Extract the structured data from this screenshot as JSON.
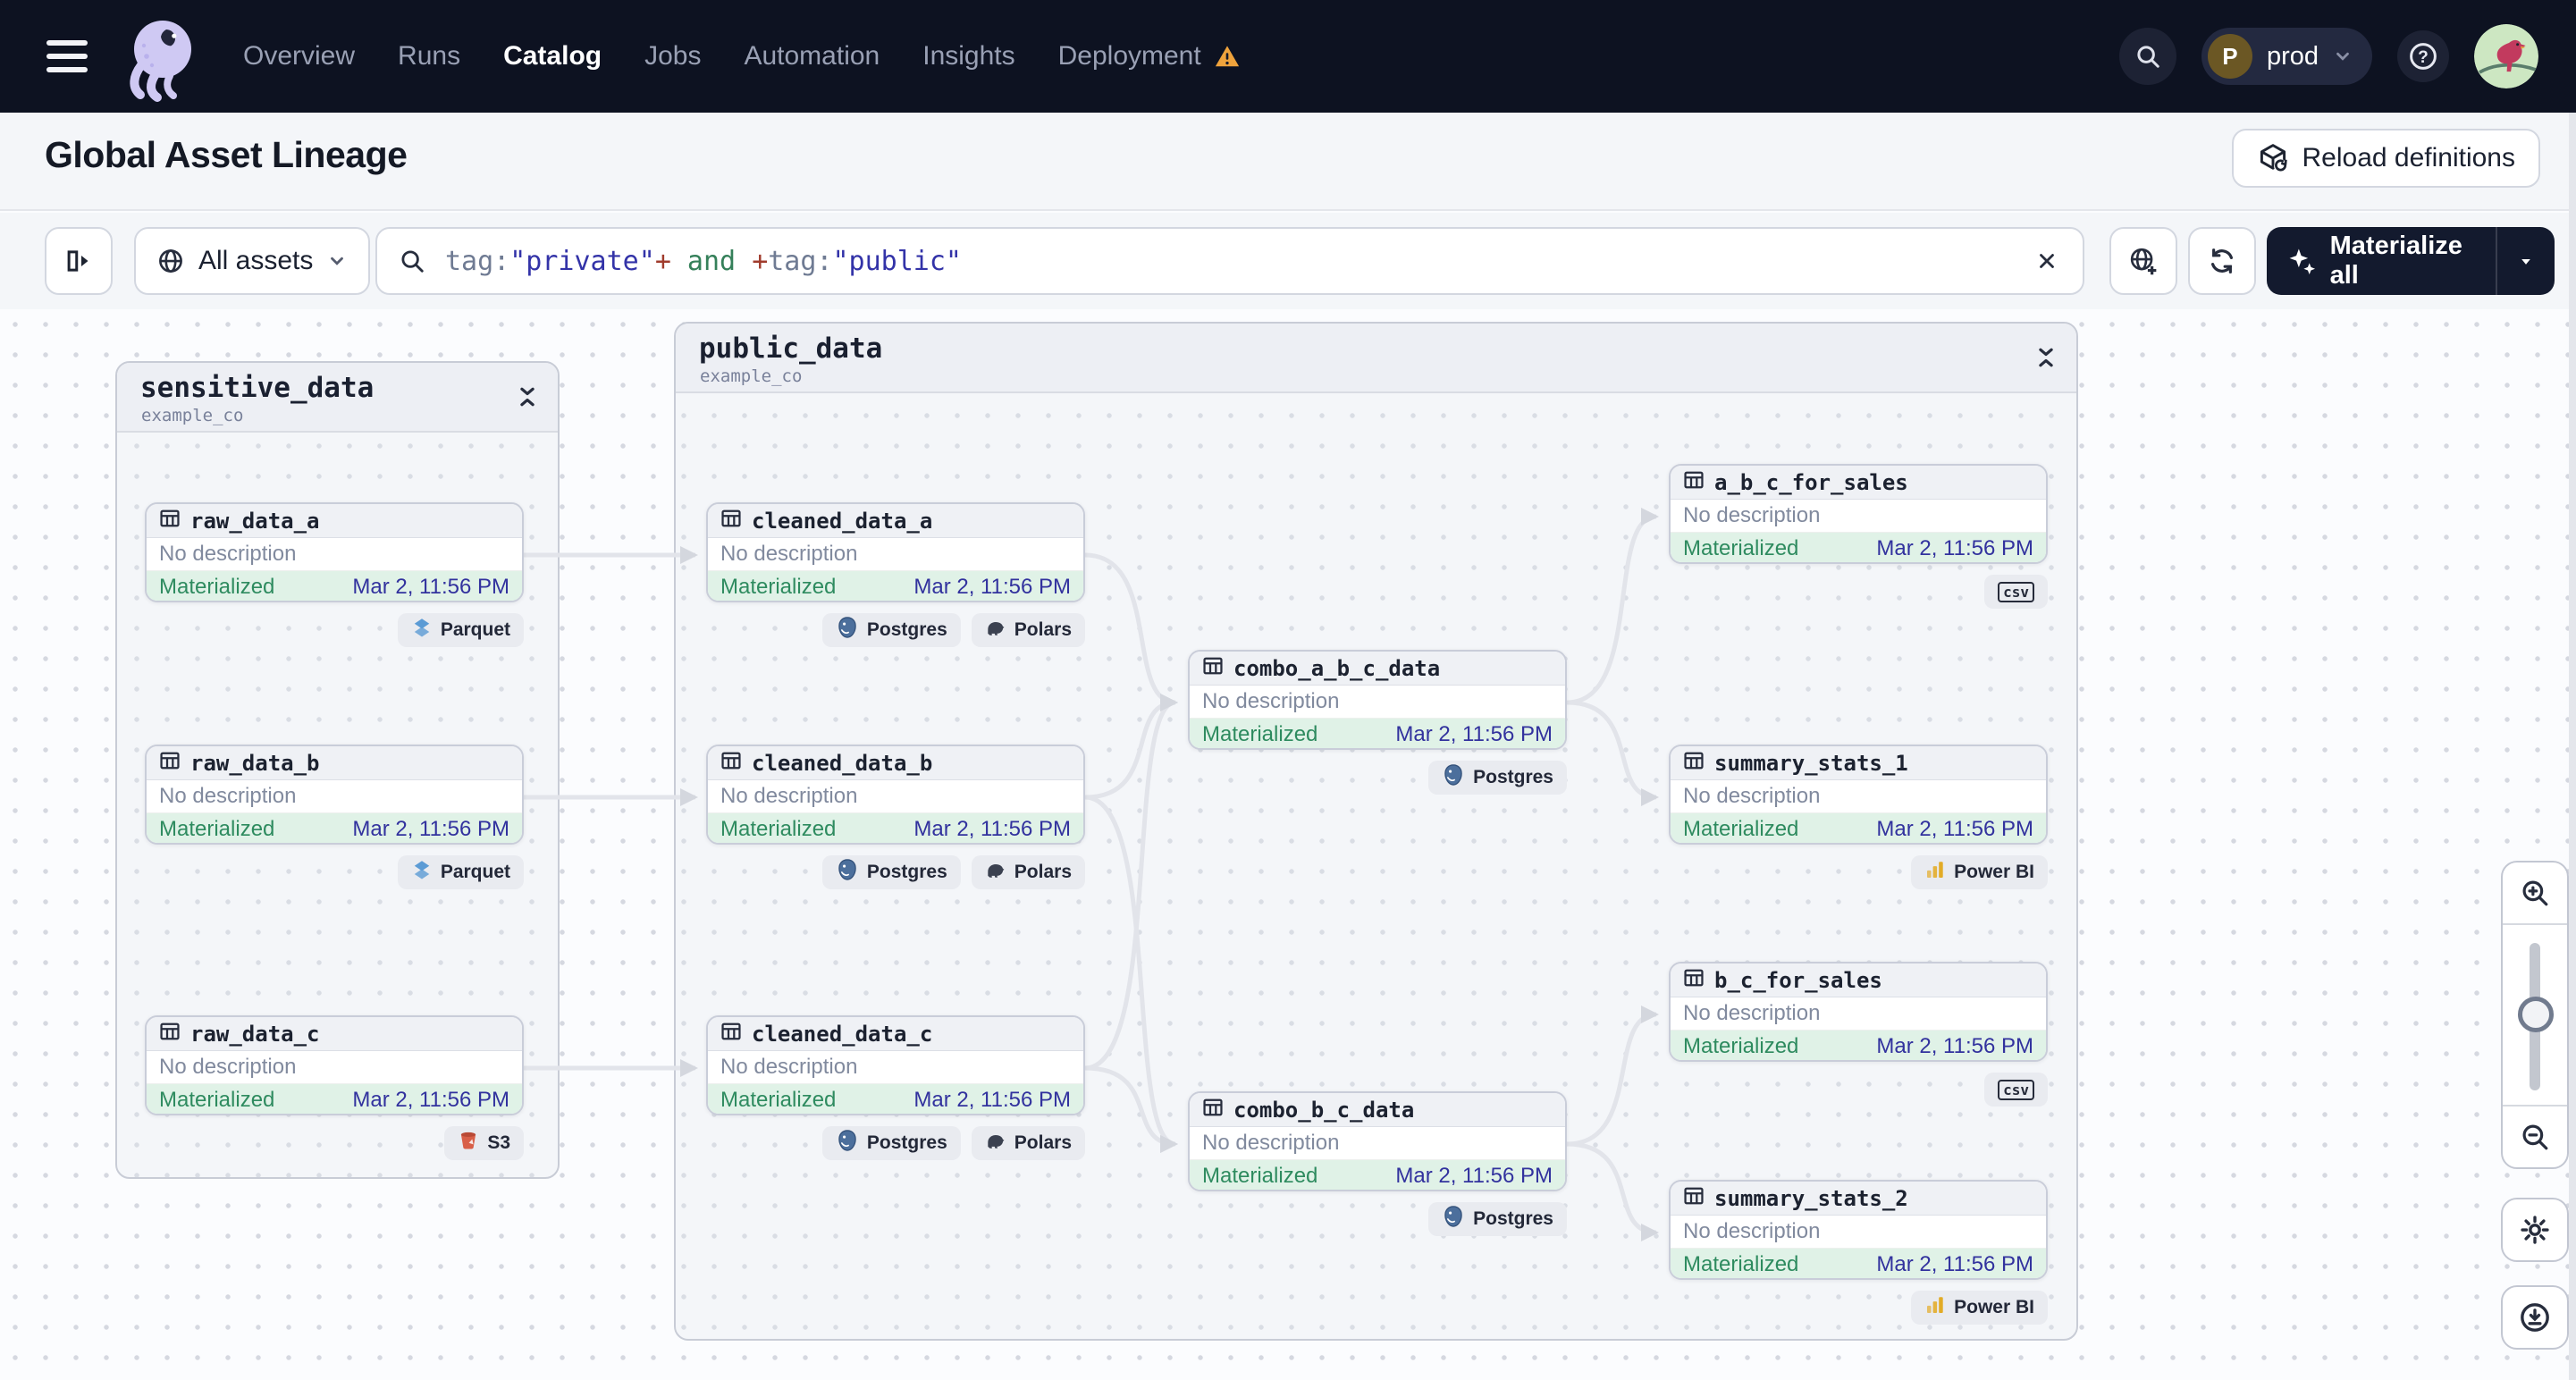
{
  "nav": {
    "items": [
      {
        "id": "overview",
        "label": "Overview",
        "active": false,
        "warning": false
      },
      {
        "id": "runs",
        "label": "Runs",
        "active": false,
        "warning": false
      },
      {
        "id": "catalog",
        "label": "Catalog",
        "active": true,
        "warning": false
      },
      {
        "id": "jobs",
        "label": "Jobs",
        "active": false,
        "warning": false
      },
      {
        "id": "automation",
        "label": "Automation",
        "active": false,
        "warning": false
      },
      {
        "id": "insights",
        "label": "Insights",
        "active": false,
        "warning": false
      },
      {
        "id": "deployment",
        "label": "Deployment",
        "active": false,
        "warning": true
      }
    ],
    "environment": {
      "initial": "P",
      "name": "prod"
    }
  },
  "header": {
    "title": "Global Asset Lineage",
    "reload_button": "Reload definitions"
  },
  "toolbar": {
    "scope": {
      "label": "All assets"
    },
    "search": {
      "tokens": [
        {
          "text": "tag:",
          "kind": "key"
        },
        {
          "text": "\"private\"",
          "kind": "string"
        },
        {
          "text": "+",
          "kind": "op"
        },
        {
          "text": " and ",
          "kind": "bool"
        },
        {
          "text": "+",
          "kind": "op"
        },
        {
          "text": "tag:",
          "kind": "key"
        },
        {
          "text": "\"public\"",
          "kind": "string"
        }
      ]
    },
    "materialize_button": "Materialize all"
  },
  "graph": {
    "groups": [
      {
        "id": "sensitive_data",
        "title": "sensitive_data",
        "subtitle": "example_co"
      },
      {
        "id": "public_data",
        "title": "public_data",
        "subtitle": "example_co"
      }
    ],
    "node_defaults": {
      "description": "No description",
      "status": "Materialized",
      "timestamp": "Mar 2, 11:56 PM"
    },
    "nodes": [
      {
        "id": "raw_data_a",
        "label": "raw_data_a",
        "group": "sensitive_data",
        "badges": [
          {
            "label": "Parquet",
            "icon": "parquet-icon"
          }
        ]
      },
      {
        "id": "raw_data_b",
        "label": "raw_data_b",
        "group": "sensitive_data",
        "badges": [
          {
            "label": "Parquet",
            "icon": "parquet-icon"
          }
        ]
      },
      {
        "id": "raw_data_c",
        "label": "raw_data_c",
        "group": "sensitive_data",
        "badges": [
          {
            "label": "S3",
            "icon": "s3-icon"
          }
        ]
      },
      {
        "id": "cleaned_data_a",
        "label": "cleaned_data_a",
        "group": "public_data",
        "badges": [
          {
            "label": "Postgres",
            "icon": "postgres-icon"
          },
          {
            "label": "Polars",
            "icon": "polars-icon"
          }
        ]
      },
      {
        "id": "cleaned_data_b",
        "label": "cleaned_data_b",
        "group": "public_data",
        "badges": [
          {
            "label": "Postgres",
            "icon": "postgres-icon"
          },
          {
            "label": "Polars",
            "icon": "polars-icon"
          }
        ]
      },
      {
        "id": "cleaned_data_c",
        "label": "cleaned_data_c",
        "group": "public_data",
        "badges": [
          {
            "label": "Postgres",
            "icon": "postgres-icon"
          },
          {
            "label": "Polars",
            "icon": "polars-icon"
          }
        ]
      },
      {
        "id": "combo_a_b_c_data",
        "label": "combo_a_b_c_data",
        "group": "public_data",
        "badges": [
          {
            "label": "Postgres",
            "icon": "postgres-icon"
          }
        ]
      },
      {
        "id": "combo_b_c_data",
        "label": "combo_b_c_data",
        "group": "public_data",
        "badges": [
          {
            "label": "Postgres",
            "icon": "postgres-icon"
          }
        ]
      },
      {
        "id": "a_b_c_for_sales",
        "label": "a_b_c_for_sales",
        "group": "public_data",
        "badges": [
          {
            "label": "",
            "icon": "csv-icon"
          }
        ]
      },
      {
        "id": "summary_stats_1",
        "label": "summary_stats_1",
        "group": "public_data",
        "badges": [
          {
            "label": "Power BI",
            "icon": "powerbi-icon"
          }
        ]
      },
      {
        "id": "b_c_for_sales",
        "label": "b_c_for_sales",
        "group": "public_data",
        "badges": [
          {
            "label": "",
            "icon": "csv-icon"
          }
        ]
      },
      {
        "id": "summary_stats_2",
        "label": "summary_stats_2",
        "group": "public_data",
        "badges": [
          {
            "label": "Power BI",
            "icon": "powerbi-icon"
          }
        ]
      }
    ],
    "edges": [
      [
        "raw_data_a",
        "cleaned_data_a"
      ],
      [
        "raw_data_b",
        "cleaned_data_b"
      ],
      [
        "raw_data_c",
        "cleaned_data_c"
      ],
      [
        "cleaned_data_a",
        "combo_a_b_c_data"
      ],
      [
        "cleaned_data_b",
        "combo_a_b_c_data"
      ],
      [
        "cleaned_data_c",
        "combo_a_b_c_data"
      ],
      [
        "cleaned_data_b",
        "combo_b_c_data"
      ],
      [
        "cleaned_data_c",
        "combo_b_c_data"
      ],
      [
        "combo_a_b_c_data",
        "a_b_c_for_sales"
      ],
      [
        "combo_a_b_c_data",
        "summary_stats_1"
      ],
      [
        "combo_b_c_data",
        "b_c_for_sales"
      ],
      [
        "combo_b_c_data",
        "summary_stats_2"
      ]
    ]
  },
  "colors": {
    "nav_bg": "#0d1221",
    "page_bg": "#f4f6f9",
    "status_green": "#2e8b5f",
    "status_bg": "#e0f2e7",
    "timestamp_blue": "#32329e",
    "warning_orange": "#efa33c",
    "materialize_bg": "#131a2e"
  }
}
